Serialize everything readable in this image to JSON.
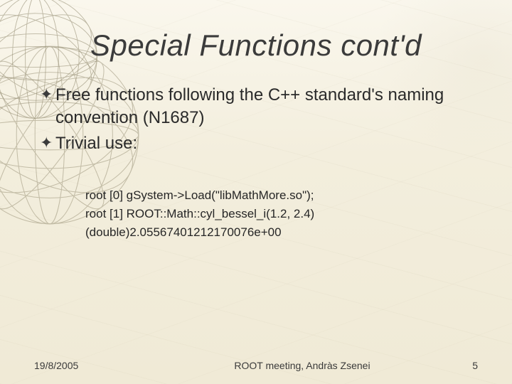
{
  "title": "Special Functions cont'd",
  "bullets": [
    {
      "text": "Free functions following the C++ standard's naming convention (N1687)"
    },
    {
      "text": "Trivial use:"
    }
  ],
  "code_lines": [
    "root [0] gSystem->Load(\"libMathMore.so\");",
    "root [1] ROOT::Math::cyl_bessel_i(1.2, 2.4)",
    "(double)2.05567401212170076e+00"
  ],
  "footer": {
    "date": "19/8/2005",
    "center": "ROOT meeting, Andràs Zsenei",
    "page": "5"
  },
  "icons": {
    "bullet": "✦"
  }
}
